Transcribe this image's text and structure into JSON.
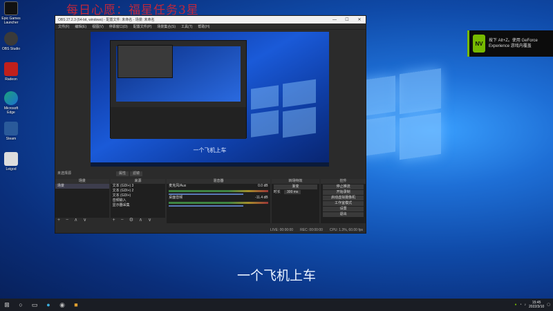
{
  "overlay": {
    "title": "每日心愿：福星任务3星",
    "subtitle": "一个飞机上车"
  },
  "desktop_icons": [
    {
      "label": "Epic Games Launcher",
      "color": "#111111"
    },
    {
      "label": "OBS Studio",
      "color": "#3a3a3a"
    },
    {
      "label": "Radeon",
      "color": "#c0201c"
    },
    {
      "label": "Microsoft Edge",
      "color": "#1ba37a"
    },
    {
      "label": "Steam",
      "color": "#2a5a9a"
    },
    {
      "label": "Leigod",
      "color": "#dddddd"
    }
  ],
  "toast": {
    "icon": "nvidia-icon",
    "message": "按下 Alt+Z。使用 GeForce Experience 游戏内覆盖"
  },
  "obs": {
    "title": "OBS 27.2.3 (64-bit, windows) - 配置文件: 未命名 - 场景: 未命名",
    "menu": [
      "文件(F)",
      "编辑(E)",
      "视图(V)",
      "停靠窗口(D)",
      "配置文件(P)",
      "场景集合(S)",
      "工具(T)",
      "帮助(H)"
    ],
    "preview_caption": "一个飞机上车",
    "mode_label": "未选择源",
    "mode_buttons": [
      "属性",
      "滤镜"
    ],
    "scenes": {
      "header": "场景",
      "items": [
        "场景"
      ]
    },
    "sources": {
      "header": "来源",
      "items": [
        "文本 (GDI+) 3",
        "文本 (GDI+) 2",
        "文本 (GDI+)",
        "音频输入",
        "显示器采集"
      ]
    },
    "mixer": {
      "header": "混音器",
      "channels": [
        {
          "name": "麦克风/Aux",
          "level": "0.0 dB"
        },
        {
          "name": "桌面音频",
          "level": "-11.4 dB"
        }
      ]
    },
    "transitions": {
      "header": "转场特效",
      "type": "渐变",
      "duration_label": "时长",
      "duration": "300 ms"
    },
    "controls": {
      "header": "控件",
      "buttons": [
        "停止推流",
        "开始录制",
        "启动虚拟摄像机",
        "工作室模式",
        "设置",
        "退出"
      ]
    },
    "status": {
      "live": "LIVE: 00:00:00",
      "rec": "REC: 00:00:00",
      "cpu": "CPU: 1.3%, 60.00 fps"
    }
  },
  "taskbar": {
    "time": "15:45",
    "date": "2022/3/10"
  }
}
